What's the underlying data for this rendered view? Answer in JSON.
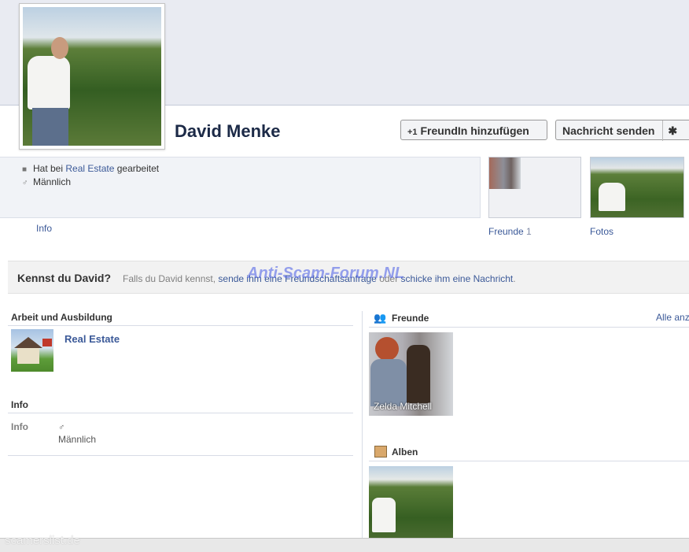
{
  "profile": {
    "name": "David Menke"
  },
  "actions": {
    "add_friend": "FreundIn hinzufügen",
    "add_friend_icon": "+1",
    "send_message": "Nachricht senden",
    "gear_icon": "✱"
  },
  "about": {
    "work_prefix": "Hat bei ",
    "work_link": "Real Estate",
    "work_suffix": " gearbeitet",
    "gender": "Männlich",
    "tab_info": "Info"
  },
  "thumbs": {
    "friends_label": "Freunde",
    "friends_count": "1",
    "photos_label": "Fotos"
  },
  "kennst": {
    "title": "Kennst du David?",
    "text_prefix": "Falls du David kennst, ",
    "link_request": "sende ihm eine Freundschaftsanfrage",
    "text_mid": " oder ",
    "link_message": "schicke ihm eine Nachricht",
    "text_suffix": "."
  },
  "watermarks": {
    "center": "Anti-Scam-Forum.NL",
    "footer": "scamerslist.de"
  },
  "left_column": {
    "work_heading": "Arbeit und Ausbildung",
    "work_item": "Real Estate",
    "info_heading": "Info",
    "info_label": "Info",
    "gender_symbol": "♂",
    "gender": "Männlich"
  },
  "right_column": {
    "friends_heading": "Freunde",
    "see_all": "Alle anz",
    "friend_name": "Zelda Mitchell",
    "albums_heading": "Alben"
  }
}
